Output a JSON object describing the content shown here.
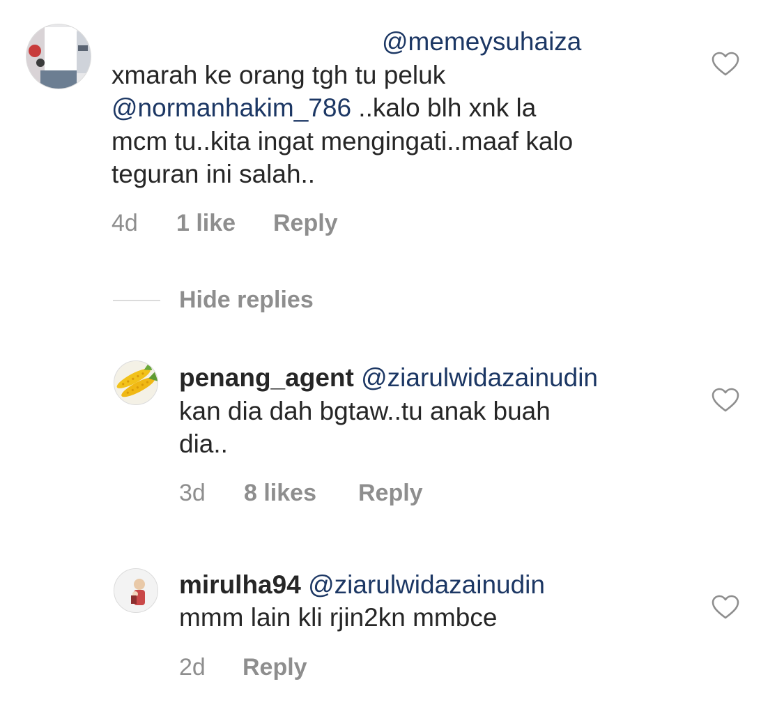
{
  "comments": [
    {
      "mention_top": "@memeysuhaiza",
      "lines": [
        {
          "text": "xmarah ke orang tgh tu peluk"
        },
        {
          "mention": "@normanhakim_786",
          "text": " ..kalo blh xnk la"
        },
        {
          "text": "mcm tu..kita ingat mengingati..maaf kalo"
        },
        {
          "text": "teguran ini salah.."
        }
      ],
      "time": "4d",
      "likes": "1 like",
      "reply_label": "Reply"
    }
  ],
  "hide_replies_label": "Hide replies",
  "replies": [
    {
      "username": "penang_agent",
      "mention": "@ziarulwidazainudin",
      "lines": [
        "kan dia dah bgtaw..tu anak buah",
        "dia.."
      ],
      "time": "3d",
      "likes": "8 likes",
      "reply_label": "Reply"
    },
    {
      "username": "mirulha94",
      "mention": "@ziarulwidazainudin",
      "lines": [
        "mmm lain kli rjin2kn mmbce"
      ],
      "time": "2d",
      "reply_label": "Reply"
    }
  ],
  "colors": {
    "text": "#262626",
    "mention": "#1c3764",
    "meta": "#8e8e8e"
  },
  "icons": {
    "like": "heart-outline-icon"
  }
}
